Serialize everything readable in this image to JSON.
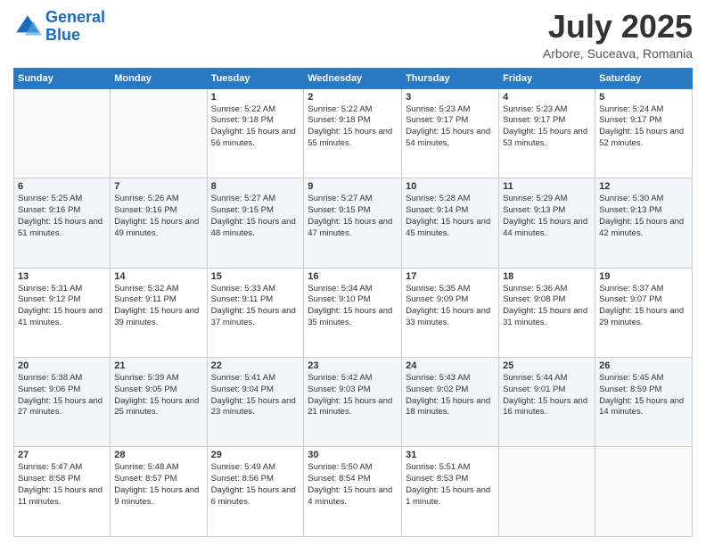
{
  "logo": {
    "line1": "General",
    "line2": "Blue"
  },
  "title": "July 2025",
  "location": "Arbore, Suceava, Romania",
  "days_header": [
    "Sunday",
    "Monday",
    "Tuesday",
    "Wednesday",
    "Thursday",
    "Friday",
    "Saturday"
  ],
  "weeks": [
    [
      {
        "day": "",
        "sunrise": "",
        "sunset": "",
        "daylight": ""
      },
      {
        "day": "",
        "sunrise": "",
        "sunset": "",
        "daylight": ""
      },
      {
        "day": "1",
        "sunrise": "Sunrise: 5:22 AM",
        "sunset": "Sunset: 9:18 PM",
        "daylight": "Daylight: 15 hours and 56 minutes."
      },
      {
        "day": "2",
        "sunrise": "Sunrise: 5:22 AM",
        "sunset": "Sunset: 9:18 PM",
        "daylight": "Daylight: 15 hours and 55 minutes."
      },
      {
        "day": "3",
        "sunrise": "Sunrise: 5:23 AM",
        "sunset": "Sunset: 9:17 PM",
        "daylight": "Daylight: 15 hours and 54 minutes."
      },
      {
        "day": "4",
        "sunrise": "Sunrise: 5:23 AM",
        "sunset": "Sunset: 9:17 PM",
        "daylight": "Daylight: 15 hours and 53 minutes."
      },
      {
        "day": "5",
        "sunrise": "Sunrise: 5:24 AM",
        "sunset": "Sunset: 9:17 PM",
        "daylight": "Daylight: 15 hours and 52 minutes."
      }
    ],
    [
      {
        "day": "6",
        "sunrise": "Sunrise: 5:25 AM",
        "sunset": "Sunset: 9:16 PM",
        "daylight": "Daylight: 15 hours and 51 minutes."
      },
      {
        "day": "7",
        "sunrise": "Sunrise: 5:26 AM",
        "sunset": "Sunset: 9:16 PM",
        "daylight": "Daylight: 15 hours and 49 minutes."
      },
      {
        "day": "8",
        "sunrise": "Sunrise: 5:27 AM",
        "sunset": "Sunset: 9:15 PM",
        "daylight": "Daylight: 15 hours and 48 minutes."
      },
      {
        "day": "9",
        "sunrise": "Sunrise: 5:27 AM",
        "sunset": "Sunset: 9:15 PM",
        "daylight": "Daylight: 15 hours and 47 minutes."
      },
      {
        "day": "10",
        "sunrise": "Sunrise: 5:28 AM",
        "sunset": "Sunset: 9:14 PM",
        "daylight": "Daylight: 15 hours and 45 minutes."
      },
      {
        "day": "11",
        "sunrise": "Sunrise: 5:29 AM",
        "sunset": "Sunset: 9:13 PM",
        "daylight": "Daylight: 15 hours and 44 minutes."
      },
      {
        "day": "12",
        "sunrise": "Sunrise: 5:30 AM",
        "sunset": "Sunset: 9:13 PM",
        "daylight": "Daylight: 15 hours and 42 minutes."
      }
    ],
    [
      {
        "day": "13",
        "sunrise": "Sunrise: 5:31 AM",
        "sunset": "Sunset: 9:12 PM",
        "daylight": "Daylight: 15 hours and 41 minutes."
      },
      {
        "day": "14",
        "sunrise": "Sunrise: 5:32 AM",
        "sunset": "Sunset: 9:11 PM",
        "daylight": "Daylight: 15 hours and 39 minutes."
      },
      {
        "day": "15",
        "sunrise": "Sunrise: 5:33 AM",
        "sunset": "Sunset: 9:11 PM",
        "daylight": "Daylight: 15 hours and 37 minutes."
      },
      {
        "day": "16",
        "sunrise": "Sunrise: 5:34 AM",
        "sunset": "Sunset: 9:10 PM",
        "daylight": "Daylight: 15 hours and 35 minutes."
      },
      {
        "day": "17",
        "sunrise": "Sunrise: 5:35 AM",
        "sunset": "Sunset: 9:09 PM",
        "daylight": "Daylight: 15 hours and 33 minutes."
      },
      {
        "day": "18",
        "sunrise": "Sunrise: 5:36 AM",
        "sunset": "Sunset: 9:08 PM",
        "daylight": "Daylight: 15 hours and 31 minutes."
      },
      {
        "day": "19",
        "sunrise": "Sunrise: 5:37 AM",
        "sunset": "Sunset: 9:07 PM",
        "daylight": "Daylight: 15 hours and 29 minutes."
      }
    ],
    [
      {
        "day": "20",
        "sunrise": "Sunrise: 5:38 AM",
        "sunset": "Sunset: 9:06 PM",
        "daylight": "Daylight: 15 hours and 27 minutes."
      },
      {
        "day": "21",
        "sunrise": "Sunrise: 5:39 AM",
        "sunset": "Sunset: 9:05 PM",
        "daylight": "Daylight: 15 hours and 25 minutes."
      },
      {
        "day": "22",
        "sunrise": "Sunrise: 5:41 AM",
        "sunset": "Sunset: 9:04 PM",
        "daylight": "Daylight: 15 hours and 23 minutes."
      },
      {
        "day": "23",
        "sunrise": "Sunrise: 5:42 AM",
        "sunset": "Sunset: 9:03 PM",
        "daylight": "Daylight: 15 hours and 21 minutes."
      },
      {
        "day": "24",
        "sunrise": "Sunrise: 5:43 AM",
        "sunset": "Sunset: 9:02 PM",
        "daylight": "Daylight: 15 hours and 18 minutes."
      },
      {
        "day": "25",
        "sunrise": "Sunrise: 5:44 AM",
        "sunset": "Sunset: 9:01 PM",
        "daylight": "Daylight: 15 hours and 16 minutes."
      },
      {
        "day": "26",
        "sunrise": "Sunrise: 5:45 AM",
        "sunset": "Sunset: 8:59 PM",
        "daylight": "Daylight: 15 hours and 14 minutes."
      }
    ],
    [
      {
        "day": "27",
        "sunrise": "Sunrise: 5:47 AM",
        "sunset": "Sunset: 8:58 PM",
        "daylight": "Daylight: 15 hours and 11 minutes."
      },
      {
        "day": "28",
        "sunrise": "Sunrise: 5:48 AM",
        "sunset": "Sunset: 8:57 PM",
        "daylight": "Daylight: 15 hours and 9 minutes."
      },
      {
        "day": "29",
        "sunrise": "Sunrise: 5:49 AM",
        "sunset": "Sunset: 8:56 PM",
        "daylight": "Daylight: 15 hours and 6 minutes."
      },
      {
        "day": "30",
        "sunrise": "Sunrise: 5:50 AM",
        "sunset": "Sunset: 8:54 PM",
        "daylight": "Daylight: 15 hours and 4 minutes."
      },
      {
        "day": "31",
        "sunrise": "Sunrise: 5:51 AM",
        "sunset": "Sunset: 8:53 PM",
        "daylight": "Daylight: 15 hours and 1 minute."
      },
      {
        "day": "",
        "sunrise": "",
        "sunset": "",
        "daylight": ""
      },
      {
        "day": "",
        "sunrise": "",
        "sunset": "",
        "daylight": ""
      }
    ]
  ]
}
